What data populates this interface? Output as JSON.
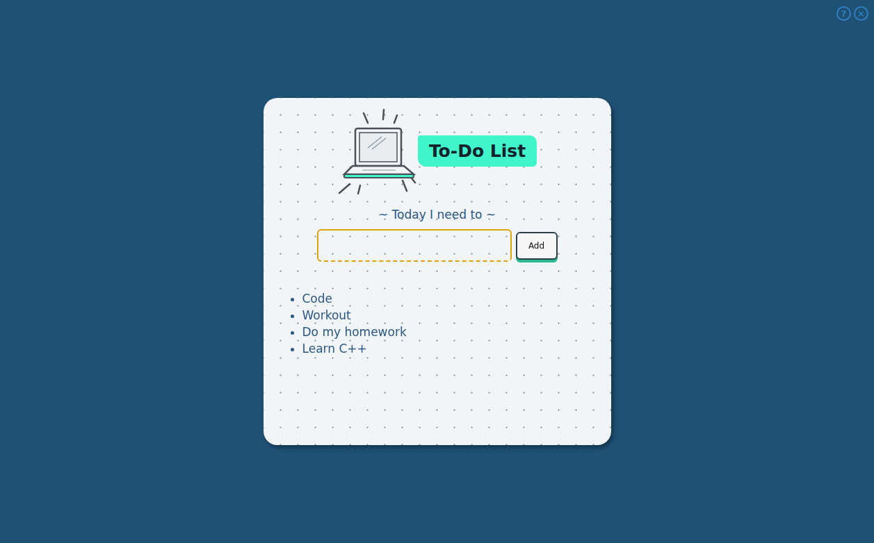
{
  "corner_buttons": [
    "?",
    "×"
  ],
  "card": {
    "title": "To-Do List",
    "subtitle": "~ Today I need to ~"
  },
  "input": {
    "value": "",
    "focused": true
  },
  "add_button": "Add",
  "items": [
    {
      "text": "Code"
    },
    {
      "text": "Workout"
    },
    {
      "text": "Do my homework"
    },
    {
      "text": "Learn C++"
    }
  ]
}
